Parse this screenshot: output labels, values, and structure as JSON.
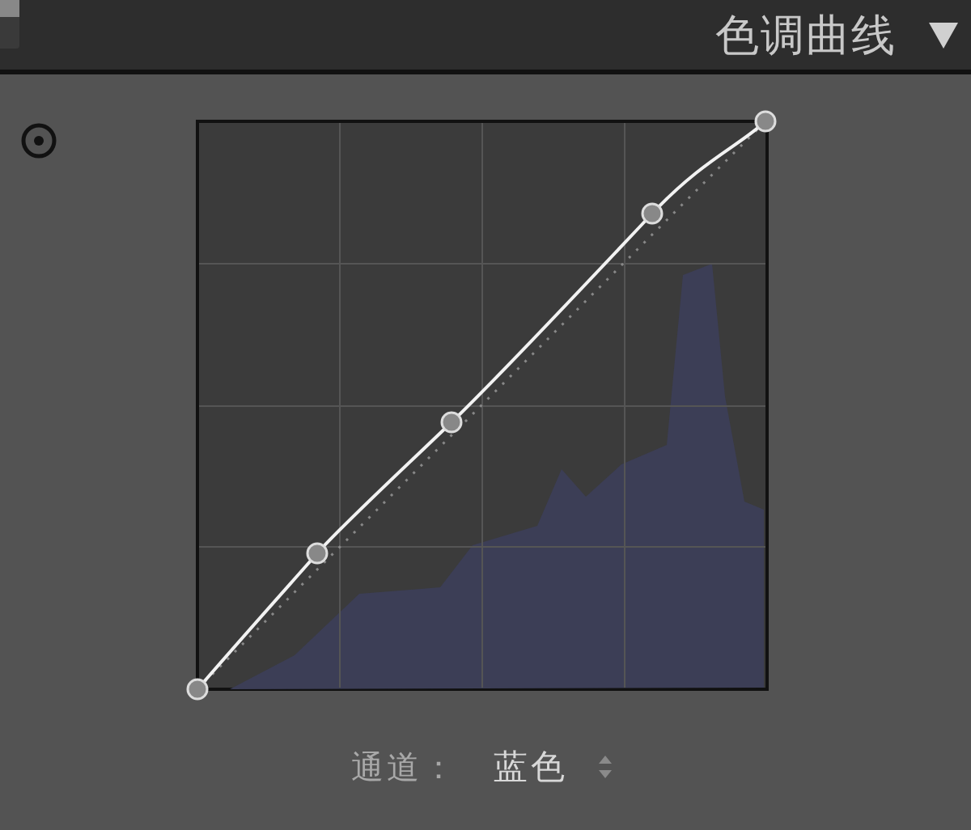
{
  "panel": {
    "title": "色调曲线"
  },
  "channel": {
    "label": "通道：",
    "value": "蓝色"
  }
}
